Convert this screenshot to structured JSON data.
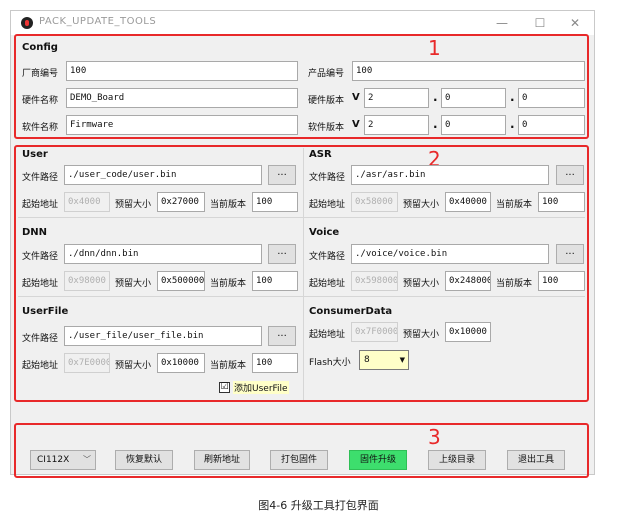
{
  "window": {
    "title": "PACK_UPDATE_TOOLS",
    "minimize": "—",
    "maximize": "☐",
    "close": "✕"
  },
  "markers": [
    "1",
    "2",
    "3"
  ],
  "config": {
    "header": "Config",
    "vendor_label": "厂商编号",
    "vendor_value": "100",
    "product_label": "产品编号",
    "product_value": "100",
    "hw_name_label": "硬件名称",
    "hw_name_value": "DEMO_Board",
    "hw_ver_label": "硬件版本",
    "hw_ver": [
      "2",
      "0",
      "0"
    ],
    "sw_name_label": "软件名称",
    "sw_name_value": "Firmware",
    "sw_ver_label": "软件版本",
    "sw_ver": [
      "2",
      "0",
      "0"
    ],
    "v": "V",
    "dot": "."
  },
  "common": {
    "path_label": "文件路径",
    "start_label": "起始地址",
    "reserve_label": "预留大小",
    "ver_label": "当前版本",
    "browse": "..."
  },
  "user": {
    "header": "User",
    "path": "./user_code/user.bin",
    "start": "0x4000",
    "reserve": "0x27000",
    "version": "100"
  },
  "asr": {
    "header": "ASR",
    "path": "./asr/asr.bin",
    "start": "0x58000",
    "reserve": "0x40000",
    "version": "100"
  },
  "dnn": {
    "header": "DNN",
    "path": "./dnn/dnn.bin",
    "start": "0x98000",
    "reserve": "0x500000",
    "version": "100"
  },
  "voice": {
    "header": "Voice",
    "path": "./voice/voice.bin",
    "start": "0x598000",
    "reserve": "0x248000",
    "version": "100"
  },
  "userfile": {
    "header": "UserFile",
    "path": "./user_file/user_file.bin",
    "start": "0x7E0000",
    "reserve": "0x10000",
    "version": "100",
    "add_label": "添加UserFile",
    "check": "☑"
  },
  "consumer": {
    "header": "ConsumerData",
    "start": "0x7F0000",
    "reserve": "0x10000",
    "flash_label": "Flash大小",
    "flash_value": "8"
  },
  "bottom": {
    "chip": "CI112X",
    "restore": "恢复默认",
    "refresh": "刷新地址",
    "pack": "打包固件",
    "upgrade": "固件升级",
    "parent": "上级目录",
    "exit": "退出工具"
  },
  "caption": "图4-6 升级工具打包界面"
}
